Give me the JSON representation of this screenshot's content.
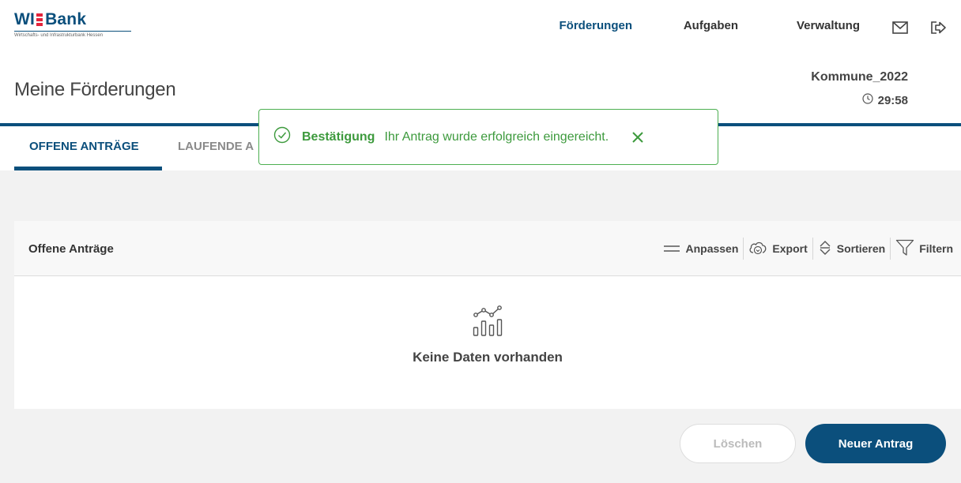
{
  "brand": {
    "logo_text": "WI Bank",
    "logo_subtitle": "Wirtschafts- und Infrastrukturbank Hessen",
    "primary_color": "#0b4f7c",
    "accent_color": "#e3243b"
  },
  "nav": {
    "items": [
      {
        "label": "Förderungen",
        "active": true
      },
      {
        "label": "Aufgaben",
        "active": false
      },
      {
        "label": "Verwaltung",
        "active": false
      }
    ],
    "icons": [
      "mail-icon",
      "logout-icon"
    ]
  },
  "page": {
    "title": "Meine Förderungen"
  },
  "session": {
    "user": "Kommune_2022",
    "timer": "29:58"
  },
  "tabs": [
    {
      "label": "OFFENE ANTRÄGE",
      "active": true
    },
    {
      "label": "LAUFENDE A",
      "active": false
    }
  ],
  "toast": {
    "title": "Bestätigung",
    "message": "Ihr Antrag wurde erfolgreich eingereicht.",
    "color": "#4caf50"
  },
  "panel": {
    "title": "Offene Anträge",
    "toolbar": [
      {
        "label": "Anpassen",
        "icon": "lines-icon"
      },
      {
        "label": "Export",
        "icon": "cloud-download-icon"
      },
      {
        "label": "Sortieren",
        "icon": "sort-icon"
      },
      {
        "label": "Filtern",
        "icon": "filter-icon"
      }
    ],
    "empty_text": "Keine Daten vorhanden"
  },
  "actions": {
    "delete_label": "Löschen",
    "new_label": "Neuer Antrag"
  }
}
